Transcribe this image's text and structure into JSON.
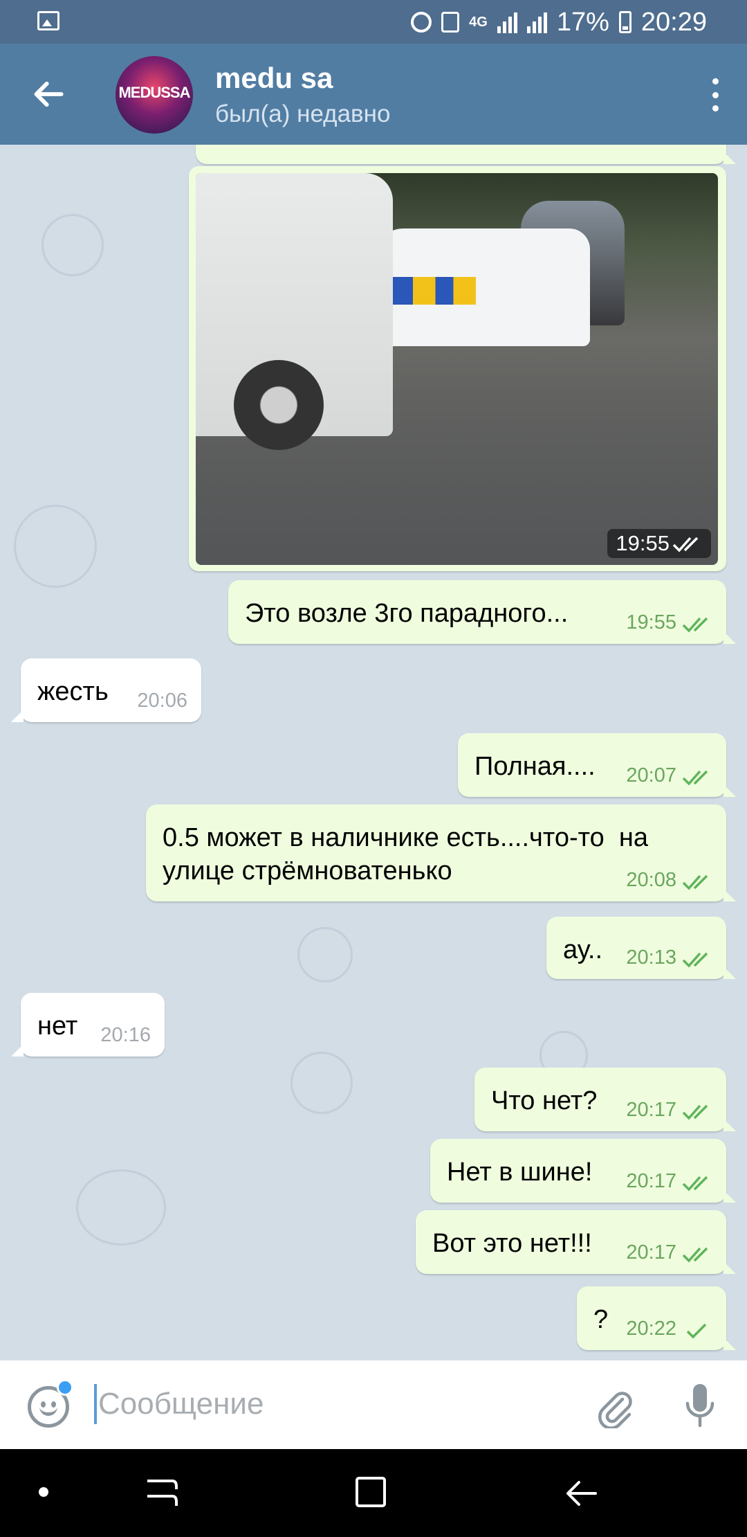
{
  "status_bar": {
    "network": "4G",
    "battery": "17%",
    "time": "20:29"
  },
  "header": {
    "avatar_text": "MEDUSSA",
    "name": "medu sa",
    "status": "был(а) недавно"
  },
  "photo_message": {
    "time": "19:55",
    "ticks": "double"
  },
  "messages": [
    {
      "dir": "out",
      "text": "Это возле 3го парадного...",
      "time": "19:55",
      "ticks": "double"
    },
    {
      "dir": "in",
      "text": "жесть",
      "time": "20:06"
    },
    {
      "dir": "out",
      "text": "Полная....",
      "time": "20:07",
      "ticks": "double"
    },
    {
      "dir": "out",
      "text": "0.5 может в наличнике есть....что-то  на\nулице стрёмноватенько",
      "time": "20:08",
      "ticks": "double"
    },
    {
      "dir": "out",
      "text": "ау..",
      "time": "20:13",
      "ticks": "double"
    },
    {
      "dir": "in",
      "text": "нет",
      "time": "20:16"
    },
    {
      "dir": "out",
      "text": "Что нет?",
      "time": "20:17",
      "ticks": "double"
    },
    {
      "dir": "out",
      "text": "Нет в шине!",
      "time": "20:17",
      "ticks": "double"
    },
    {
      "dir": "out",
      "text": "Вот это нет!!!",
      "time": "20:17",
      "ticks": "double"
    },
    {
      "dir": "out",
      "text": "?",
      "time": "20:22",
      "ticks": "single"
    }
  ],
  "input": {
    "placeholder": "Сообщение",
    "value": ""
  },
  "colors": {
    "header": "#527da3",
    "statusbar": "#4f6d8e",
    "outgoing_bubble": "#effdde",
    "incoming_bubble": "#ffffff",
    "tick": "#5fb45b",
    "badge": "#3b9ef5"
  },
  "icons": {
    "back": "arrow-left-icon",
    "menu": "more-vertical-icon",
    "emoji": "smiley-icon",
    "attach": "paperclip-icon",
    "mic": "microphone-icon"
  }
}
